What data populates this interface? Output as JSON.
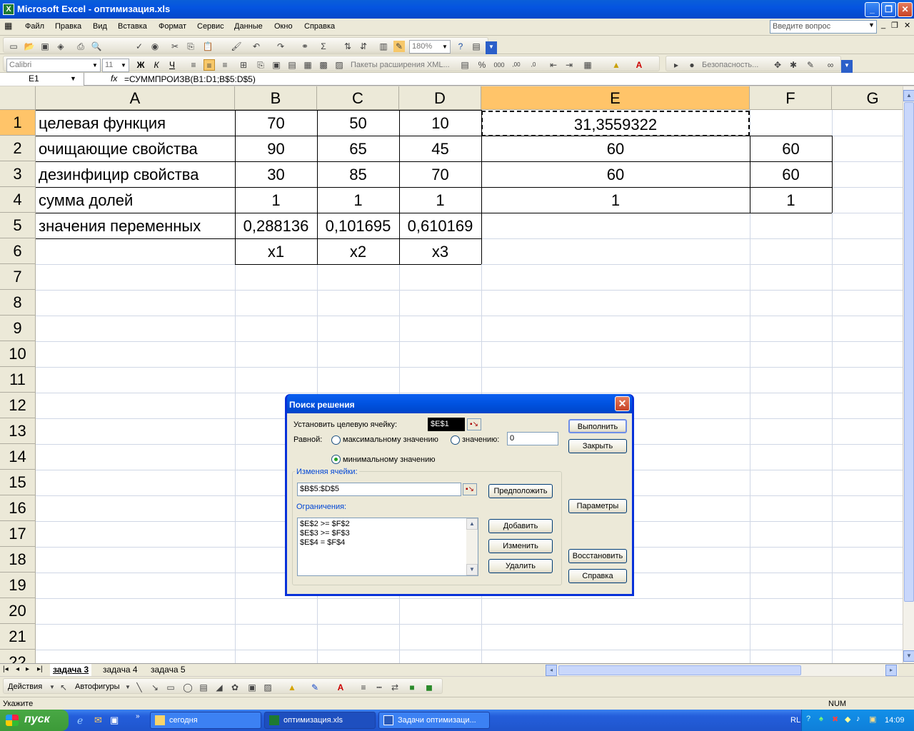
{
  "window": {
    "title": "Microsoft Excel - оптимизация.xls",
    "app_icon": "X"
  },
  "menu": {
    "items": [
      "Файл",
      "Правка",
      "Вид",
      "Вставка",
      "Формат",
      "Сервис",
      "Данные",
      "Окно",
      "Справка"
    ],
    "ask_placeholder": "Введите вопрос"
  },
  "toolbar": {
    "zoom": "180%",
    "font_name": "Calibri",
    "font_size": "11",
    "bold": "Ж",
    "italic": "К",
    "underline": "Ч",
    "xml_packs": "Пакеты расширения XML...",
    "security": "Безопасность..."
  },
  "formula_bar": {
    "name_box": "E1",
    "fx": "fx",
    "formula": "=СУММПРОИЗВ(B1:D1;B$5:D$5)"
  },
  "grid": {
    "columns": [
      "A",
      "B",
      "C",
      "D",
      "E",
      "F",
      "G"
    ],
    "rows": [
      "1",
      "2",
      "3",
      "4",
      "5",
      "6",
      "7",
      "8",
      "9",
      "10",
      "11",
      "12",
      "13",
      "14",
      "15",
      "16",
      "17",
      "18",
      "19",
      "20",
      "21",
      "22"
    ],
    "cells": {
      "A1": "целевая функция",
      "B1": "70",
      "C1": "50",
      "D1": "10",
      "E1": "31,3559322",
      "A2": "очищающие свойства",
      "B2": "90",
      "C2": "65",
      "D2": "45",
      "E2": "60",
      "F2": "60",
      "A3": "дезинфицир свойства",
      "B3": "30",
      "C3": "85",
      "D3": "70",
      "E3": "60",
      "F3": "60",
      "A4": "сумма долей",
      "B4": "1",
      "C4": "1",
      "D4": "1",
      "E4": "1",
      "F4": "1",
      "A5": "значения переменных",
      "B5": "0,288136",
      "C5": "0,101695",
      "D5": "0,610169",
      "B6": "x1",
      "C6": "x2",
      "D6": "x3"
    }
  },
  "sheets": {
    "tabs": [
      "задача 3",
      "задача 4",
      "задача 5"
    ],
    "active": 0
  },
  "drawing": {
    "actions": "Действия",
    "autoshapes": "Автофигуры"
  },
  "status": {
    "left": "Укажите",
    "num": "NUM"
  },
  "taskbar": {
    "start": "пуск",
    "tasks": [
      "сегодня",
      "оптимизация.xls",
      "Задачи оптимизаци..."
    ],
    "lang": "RL",
    "clock": "14:09"
  },
  "solver": {
    "title": "Поиск решения",
    "target_label": "Установить целевую ячейку:",
    "target_value": "$E$1",
    "equal_label": "Равной:",
    "opt_max": "максимальному значению",
    "opt_value": "значению:",
    "value_input": "0",
    "opt_min": "минимальному значению",
    "changing_label": "Изменяя ячейки:",
    "changing_value": "$B$5:$D$5",
    "constraints_label": "Ограничения:",
    "constraints": [
      "$E$2 >= $F$2",
      "$E$3 >= $F$3",
      "$E$4 = $F$4"
    ],
    "btn_solve": "Выполнить",
    "btn_close": "Закрыть",
    "btn_guess": "Предположить",
    "btn_options": "Параметры",
    "btn_add": "Добавить",
    "btn_change": "Изменить",
    "btn_delete": "Удалить",
    "btn_reset": "Восстановить",
    "btn_help": "Справка",
    "selected_option": "min"
  },
  "colors": {
    "selection_header": "#ffc469",
    "title_blue": "#0a5fd8"
  }
}
